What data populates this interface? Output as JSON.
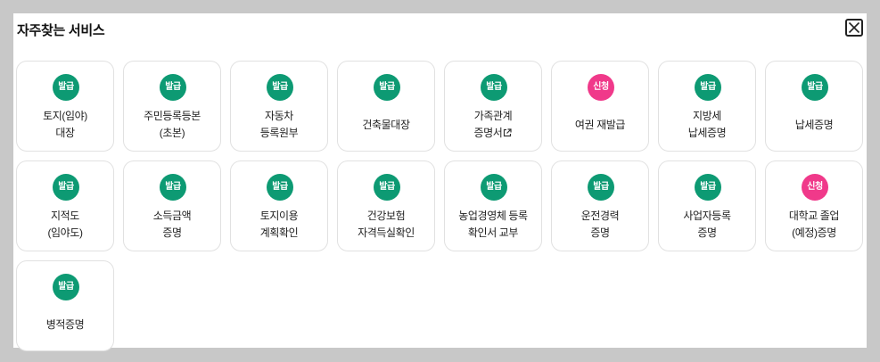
{
  "title": "자주찾는 서비스",
  "colors": {
    "issue_badge": "#0d9a73",
    "apply_badge": "#f0398a"
  },
  "close_icon": "close-icon",
  "services": [
    {
      "badge": "발급",
      "type": "issue",
      "line1": "토지(임야)",
      "line2": "대장"
    },
    {
      "badge": "발급",
      "type": "issue",
      "line1": "주민등록등본",
      "line2": "(초본)"
    },
    {
      "badge": "발급",
      "type": "issue",
      "line1": "자동차",
      "line2": "등록원부"
    },
    {
      "badge": "발급",
      "type": "issue",
      "line1": "건축물대장",
      "line2": ""
    },
    {
      "badge": "발급",
      "type": "issue",
      "line1": "가족관계",
      "line2": "증명서",
      "external": true
    },
    {
      "badge": "신청",
      "type": "apply",
      "line1": "여권 재발급",
      "line2": ""
    },
    {
      "badge": "발급",
      "type": "issue",
      "line1": "지방세",
      "line2": "납세증명"
    },
    {
      "badge": "발급",
      "type": "issue",
      "line1": "납세증명",
      "line2": ""
    },
    {
      "badge": "발급",
      "type": "issue",
      "line1": "지적도",
      "line2": "(임야도)"
    },
    {
      "badge": "발급",
      "type": "issue",
      "line1": "소득금액",
      "line2": "증명"
    },
    {
      "badge": "발급",
      "type": "issue",
      "line1": "토지이용",
      "line2": "계획확인"
    },
    {
      "badge": "발급",
      "type": "issue",
      "line1": "건강보험",
      "line2": "자격득실확인"
    },
    {
      "badge": "발급",
      "type": "issue",
      "line1": "농업경영체 등록",
      "line2": "확인서 교부"
    },
    {
      "badge": "발급",
      "type": "issue",
      "line1": "운전경력",
      "line2": "증명"
    },
    {
      "badge": "발급",
      "type": "issue",
      "line1": "사업자등록",
      "line2": "증명"
    },
    {
      "badge": "신청",
      "type": "apply",
      "line1": "대학교 졸업",
      "line2": "(예정)증명"
    },
    {
      "badge": "발급",
      "type": "issue",
      "line1": "병적증명",
      "line2": ""
    }
  ]
}
